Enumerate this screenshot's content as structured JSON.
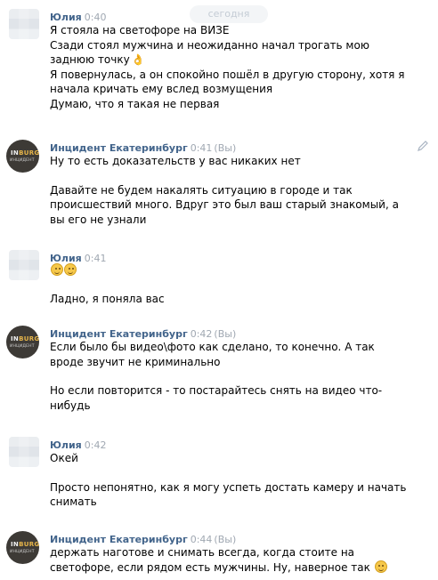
{
  "date_separator": "сегодня",
  "messages": [
    {
      "author": "Юлия",
      "time": "0:40",
      "you": "",
      "paragraphs": [
        [
          "Я стояла на светофоре на ВИЗЕ",
          "Сзади стоял мужчина и неожиданно начал трогать мою",
          "заднюю точку",
          "Я повернулась, а он спокойно пошёл в другую сторону, хотя я",
          "начала кричать ему вслед возмущения",
          "Думаю, что я такая не первая"
        ]
      ]
    },
    {
      "author": "Инцидент Екатеринбург",
      "time": "0:41",
      "you": "(Вы)",
      "paragraphs": [
        [
          "Ну то есть доказательств у вас никаких нет"
        ],
        [
          "Давайте не будем накалять ситуацию в городе и так",
          "происшествий много. Вдруг это был ваш старый знакомый, а",
          "вы его не узнали"
        ]
      ]
    },
    {
      "author": "Юлия",
      "time": "0:41",
      "you": "",
      "paragraphs": [
        [
          "Ладно, я поняла вас"
        ]
      ]
    },
    {
      "author": "Инцидент Екатеринбург",
      "time": "0:42",
      "you": "(Вы)",
      "paragraphs": [
        [
          "Если было бы видео\\фото как сделано, то конечно. А так",
          "вроде звучит не криминально"
        ],
        [
          "Но если повторится - то постарайтесь снять на видео что-",
          "нибудь"
        ]
      ]
    },
    {
      "author": "Юлия",
      "time": "0:42",
      "you": "",
      "paragraphs": [
        [
          "Окей"
        ],
        [
          "Просто непонятно, как я могу успеть достать камеру и начать",
          "снимать"
        ]
      ]
    },
    {
      "author": "Инцидент Екатеринбург",
      "time": "0:44",
      "you": "(Вы)",
      "paragraphs": [
        [
          "держать наготове и снимать всегда, когда стоите на",
          "светофоре, если рядом есть мужчины. Ну, наверное так"
        ]
      ]
    }
  ],
  "avatar_logo": {
    "line1_a": "IN",
    "line1_b": "BURG",
    "line2": "ИНЦИДЕНТ"
  },
  "colors": {
    "author": "#42648b",
    "meta": "#a0a8b2",
    "date_badge_bg": "#f3f5f7"
  },
  "icons": {
    "reaction_ok": "ok-hand-icon",
    "reaction_laugh": "laughing-emoji-icon",
    "reaction_smile": "smiling-emoji-icon",
    "edit": "pencil-edit-icon"
  }
}
